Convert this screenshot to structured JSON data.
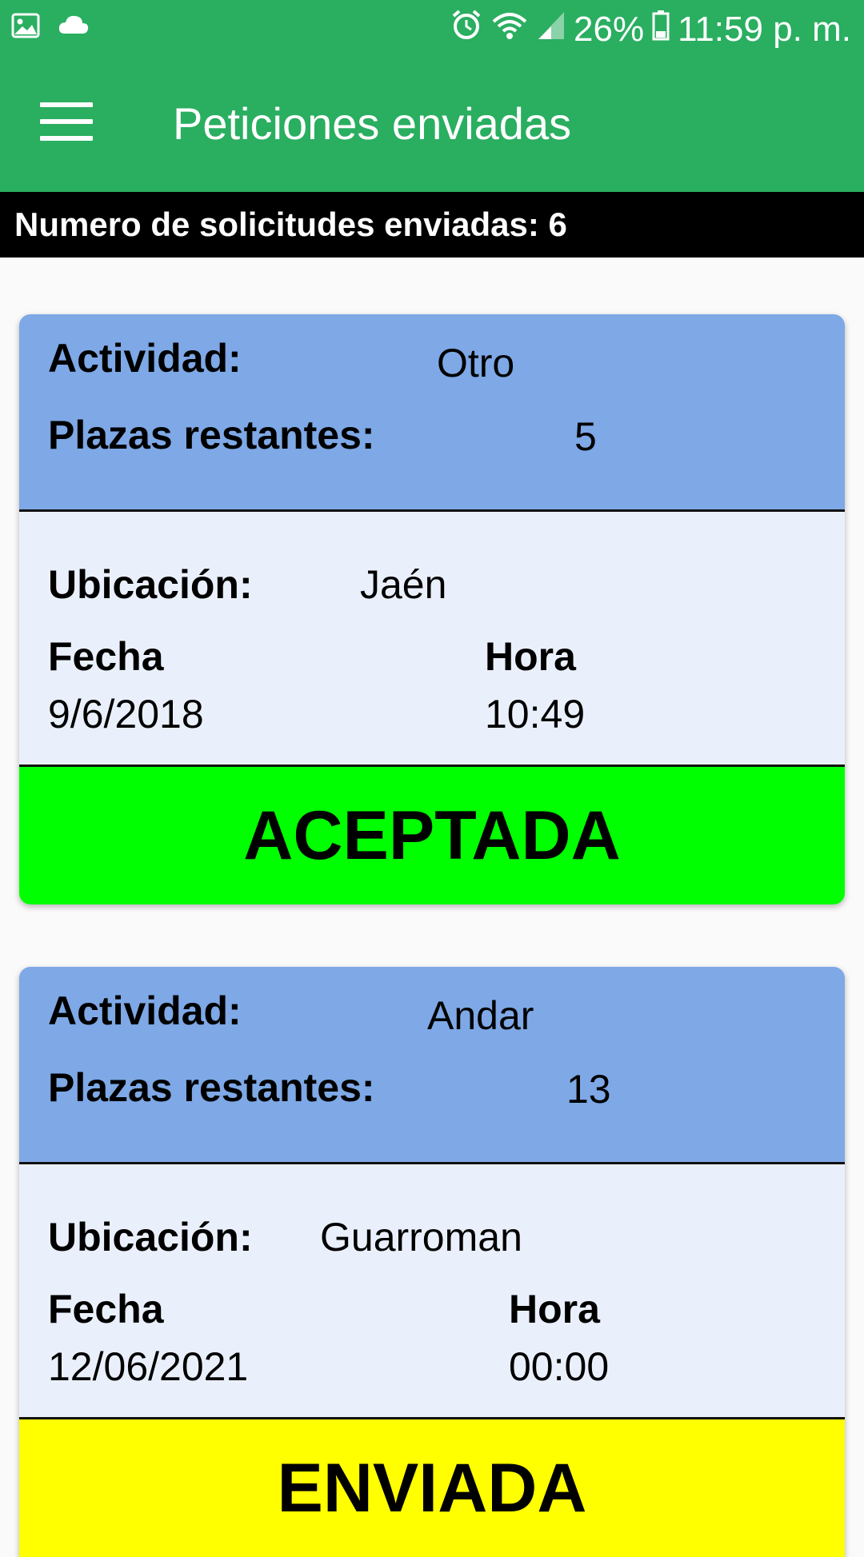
{
  "status_bar": {
    "battery": "26%",
    "time": "11:59 p. m.",
    "icons": [
      "image-icon",
      "cloud-icon",
      "alarm-icon",
      "wifi-icon",
      "signal-icon",
      "battery-icon"
    ]
  },
  "app_bar": {
    "title": "Peticiones enviadas",
    "menu_icon": "hamburger-menu-icon"
  },
  "counter": {
    "text": "Numero de solicitudes enviadas: 6"
  },
  "labels": {
    "activity": "Actividad:",
    "seats": "Plazas restantes:",
    "location": "Ubicación:",
    "date": "Fecha",
    "time": "Hora"
  },
  "requests": [
    {
      "activity": "Otro",
      "seats": "5",
      "location": "Jaén",
      "date": "9/6/2018",
      "time": "10:49",
      "status": "ACEPTADA",
      "status_color": "#00ff00"
    },
    {
      "activity": "Andar",
      "seats": "13",
      "location": "Guarroman",
      "date": "12/06/2021",
      "time": "00:00",
      "status": "ENVIADA",
      "status_color": "#ffff00"
    }
  ],
  "colors": {
    "primary_green": "#2aae60",
    "card_header_blue": "#7ea8e6",
    "card_body": "#eaf0fb"
  }
}
